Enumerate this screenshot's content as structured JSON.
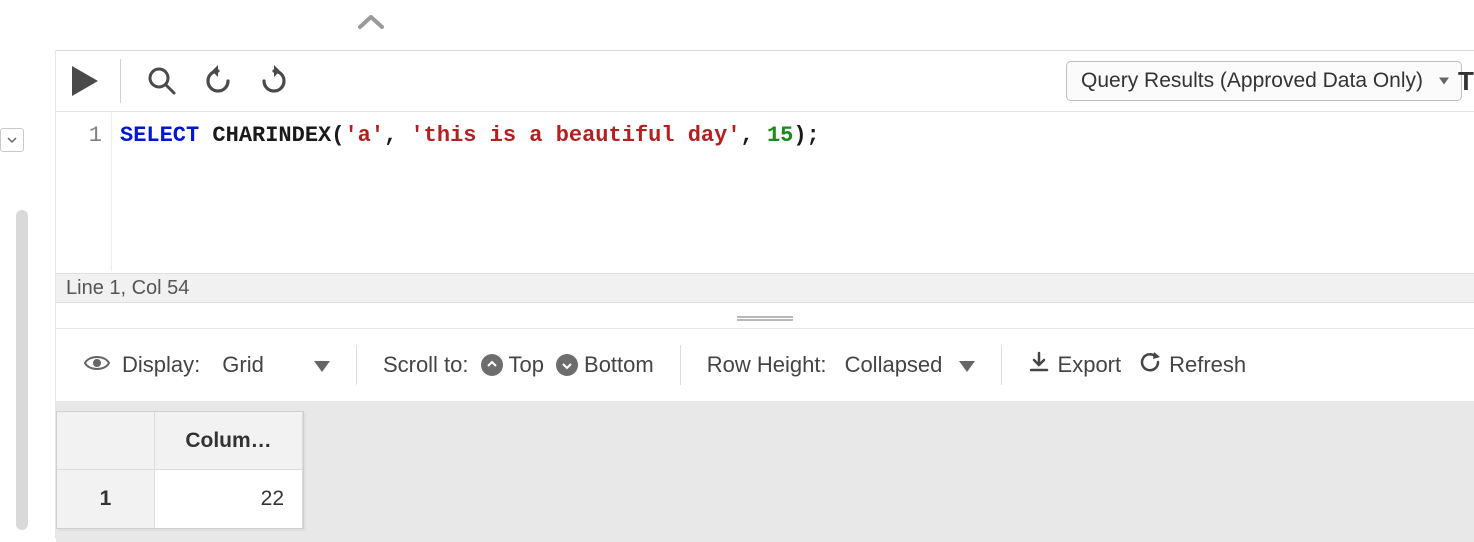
{
  "toolbar": {
    "result_mode": "Query Results (Approved Data Only)",
    "right_trunc": "T"
  },
  "editor": {
    "line_number": "1",
    "tokens": {
      "kw_select": "SELECT",
      "space1": " ",
      "fn_name": "CHARINDEX",
      "lparen": "(",
      "str1": "'a'",
      "comma1": ", ",
      "str2": "'this is a beautiful day'",
      "comma2": ", ",
      "num1": "15",
      "rparen": ")",
      "semi": ";"
    }
  },
  "status": {
    "cursor": "Line 1, Col 54"
  },
  "results_toolbar": {
    "display_label": "Display:",
    "display_value": "Grid",
    "scroll_label": "Scroll to:",
    "top_label": "Top",
    "bottom_label": "Bottom",
    "rowheight_label": "Row Height:",
    "rowheight_value": "Collapsed",
    "export_label": "Export",
    "refresh_label": "Refresh"
  },
  "grid": {
    "col_header_trunc": "Colum…",
    "rows": [
      {
        "rownum": "1",
        "value": "22"
      }
    ]
  }
}
